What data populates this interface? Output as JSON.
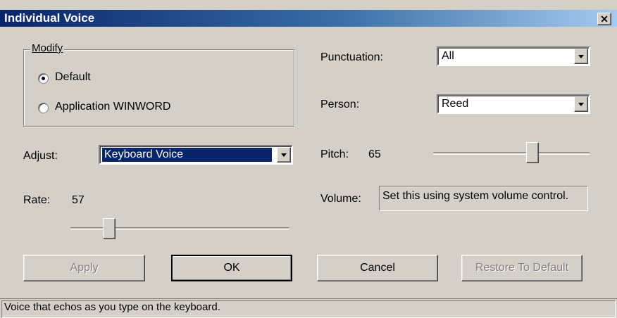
{
  "window": {
    "title": "Individual Voice",
    "close_glyph": "✕"
  },
  "modify": {
    "legend": "Modify",
    "options": [
      {
        "label": "Default",
        "checked": true
      },
      {
        "label": "Application WINWORD",
        "checked": false
      }
    ]
  },
  "punctuation": {
    "label": "Punctuation:",
    "value": "All"
  },
  "person": {
    "label": "Person:",
    "value": "Reed"
  },
  "adjust": {
    "label": "Adjust:",
    "value": "Keyboard Voice"
  },
  "pitch": {
    "label": "Pitch:",
    "value": "65"
  },
  "rate": {
    "label": "Rate:",
    "value": "57"
  },
  "volume": {
    "label": "Volume:",
    "value": "Set this using system volume control."
  },
  "buttons": {
    "apply": "Apply",
    "ok": "OK",
    "cancel": "Cancel",
    "restore": "Restore To Default"
  },
  "status": "Voice that echos as you type on the keyboard.",
  "colors": {
    "title_start": "#0a246a",
    "title_end": "#a6caf0",
    "selection": "#0a246a",
    "face": "#d4d0c8"
  }
}
